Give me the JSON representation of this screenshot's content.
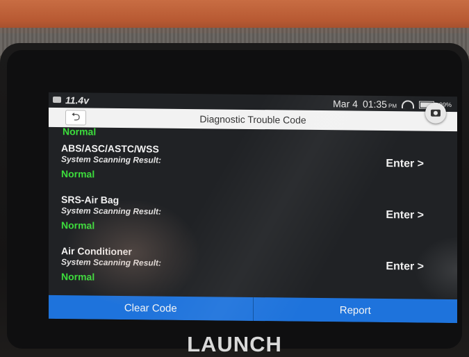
{
  "device": {
    "brand": "LAUNCH"
  },
  "status_bar": {
    "voltage": "11.4v",
    "date": "Mar 4",
    "time": "01:35",
    "ampm": "PM",
    "battery": "99%"
  },
  "header": {
    "title": "Diagnostic Trouble Code",
    "back_icon": "back-arrow-icon",
    "camera_icon": "camera-icon"
  },
  "list": {
    "partial_status": "Normal",
    "items": [
      {
        "name": "ABS/ASC/ASTC/WSS",
        "sub": "System Scanning Result:",
        "status": "Normal",
        "action": "Enter >"
      },
      {
        "name": "SRS-Air Bag",
        "sub": "System Scanning Result:",
        "status": "Normal",
        "action": "Enter >"
      },
      {
        "name": "Air Conditioner",
        "sub": "System Scanning Result:",
        "status": "Normal",
        "action": "Enter >"
      }
    ]
  },
  "footer": {
    "clear_label": "Clear Code",
    "report_label": "Report"
  },
  "colors": {
    "accent": "#1e73dc",
    "normal_status": "#3cdc3c",
    "device_rim": "#c86d43"
  }
}
